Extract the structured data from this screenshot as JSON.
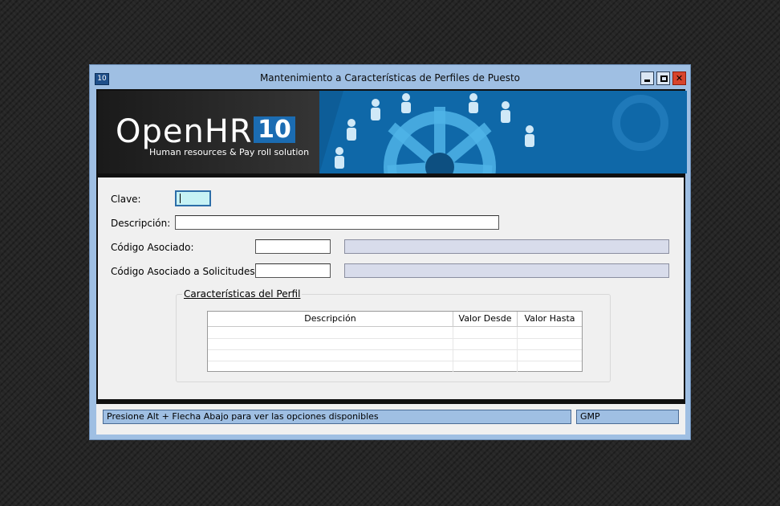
{
  "window": {
    "icon_text": "10",
    "title": "Mantenimiento a Características de Perfiles de Puesto"
  },
  "banner": {
    "brand": "OpenHR",
    "version": "10",
    "tagline": "Human resources & Pay roll solution"
  },
  "form": {
    "clave_label": "Clave:",
    "clave_value": "",
    "descripcion_label": "Descripción:",
    "descripcion_value": "",
    "codigo_asociado_label": "Código Asociado:",
    "codigo_asociado_value": "",
    "codigo_asociado_desc": "",
    "codigo_solicitudes_label": "Código Asociado a Solicitudes:",
    "codigo_solicitudes_value": "",
    "codigo_solicitudes_desc": ""
  },
  "group": {
    "title": "Características del Perfil",
    "columns": [
      "Descripción",
      "Valor Desde",
      "Valor Hasta"
    ],
    "rows": [
      [
        "",
        "",
        ""
      ],
      [
        "",
        "",
        ""
      ],
      [
        "",
        "",
        ""
      ],
      [
        "",
        "",
        ""
      ]
    ]
  },
  "status": {
    "hint": "Presione Alt + Flecha Abajo para ver las opciones disponibles",
    "user": "GMP"
  },
  "colors": {
    "window_frame": "#9fbfe3",
    "focus_field": "#c6f2f5",
    "readonly_field": "#d8dceb",
    "close_button": "#d8442c"
  }
}
